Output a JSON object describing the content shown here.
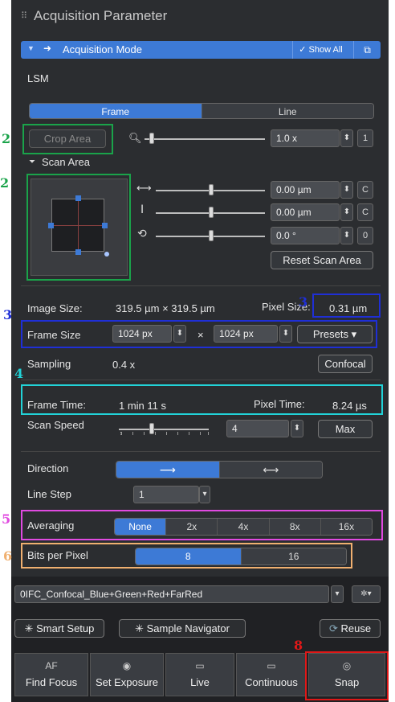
{
  "header": {
    "title": "Acquisition Parameter"
  },
  "acq_mode": {
    "title": "Acquisition Mode",
    "show_all": "Show All"
  },
  "mode": "LSM",
  "scan_tabs": [
    "Frame",
    "Line"
  ],
  "crop": {
    "label": "Crop Area",
    "zoom_value": "1.0 x",
    "zoom_reset": "1"
  },
  "scan_area": {
    "title": "Scan Area",
    "offset_x": "0.00 µm",
    "offset_y": "0.00 µm",
    "rotation": "0.0 °",
    "reset_x": "C",
    "reset_y": "C",
    "reset_rot": "0",
    "reset_button": "Reset Scan Area"
  },
  "image_size": {
    "label": "Image Size:",
    "value": "319.5 µm × 319.5 µm",
    "pixel_label": "Pixel Size:",
    "pixel_value": "0.31 µm"
  },
  "frame_size": {
    "label": "Frame Size",
    "x": "1024 px",
    "times": "×",
    "y": "1024 px",
    "presets": "Presets ▾"
  },
  "sampling": {
    "label": "Sampling",
    "value": "0.4 x",
    "button": "Confocal"
  },
  "timing": {
    "frame_label": "Frame Time:",
    "frame_value": "1 min 11 s",
    "pixel_label": "Pixel Time:",
    "pixel_value": "8.24 µs"
  },
  "scan_speed": {
    "label": "Scan Speed",
    "value": "4",
    "max": "Max"
  },
  "direction": {
    "label": "Direction"
  },
  "line_step": {
    "label": "Line Step",
    "value": "1"
  },
  "averaging": {
    "label": "Averaging",
    "options": [
      "None",
      "2x",
      "4x",
      "8x",
      "16x"
    ]
  },
  "bits": {
    "label": "Bits per Pixel",
    "options": [
      "8",
      "16"
    ]
  },
  "config": {
    "name": "0IFC_Confocal_Blue+Green+Red+FarRed"
  },
  "setup": {
    "smart": "Smart Setup",
    "navigator": "Sample Navigator",
    "reuse": "Reuse"
  },
  "toolbar": [
    {
      "icon": "AF",
      "label": "Find Focus"
    },
    {
      "icon": "camera",
      "label": "Set Exposure"
    },
    {
      "icon": "live",
      "label": "Live"
    },
    {
      "icon": "continuous",
      "label": "Continuous"
    },
    {
      "icon": "snap",
      "label": "Snap"
    }
  ],
  "annotations": [
    "2",
    "2",
    "3",
    "3",
    "4",
    "5",
    "6",
    "8"
  ],
  "colors": {
    "accent": "#3d7ad6",
    "green": "#1aa34a",
    "blue": "#1f2fd6",
    "cyan": "#22d3d8",
    "magenta": "#e04ae0",
    "orange": "#f0b070",
    "red": "#e01818"
  }
}
